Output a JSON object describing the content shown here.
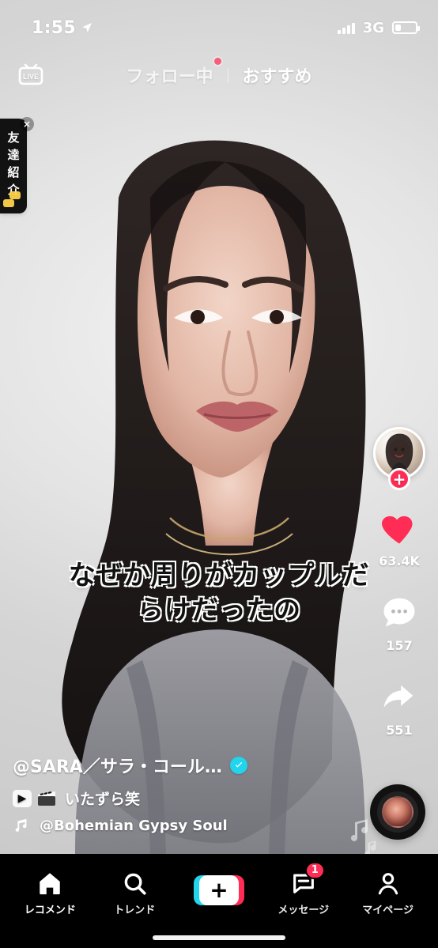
{
  "status_bar": {
    "time": "1:55",
    "network": "3G",
    "battery_level": 0.28
  },
  "top_nav": {
    "live_label": "LIVE",
    "tabs": {
      "following": "フォロー中",
      "for_you": "おすすめ"
    }
  },
  "left_badge": {
    "chars": [
      "友",
      "達",
      "紹",
      "介"
    ],
    "close": "×"
  },
  "caption": {
    "lines": [
      "なぜか周りがカップルだ",
      "らけだったの"
    ]
  },
  "right_rail": {
    "likes": "63.4K",
    "comments": "157",
    "shares": "551"
  },
  "bottom_info": {
    "username": "@SARA／サラ・コール…",
    "description": "いたずら笑",
    "music": "@Bohemian Gypsy Soul"
  },
  "bottom_nav": {
    "items": [
      {
        "label": "レコメンド"
      },
      {
        "label": "トレンド"
      },
      {
        "label": ""
      },
      {
        "label": "メッセージ",
        "badge": "1"
      },
      {
        "label": "マイページ"
      }
    ]
  },
  "colors": {
    "accent_red": "#ff2d55",
    "accent_cyan": "#20d5ec"
  }
}
